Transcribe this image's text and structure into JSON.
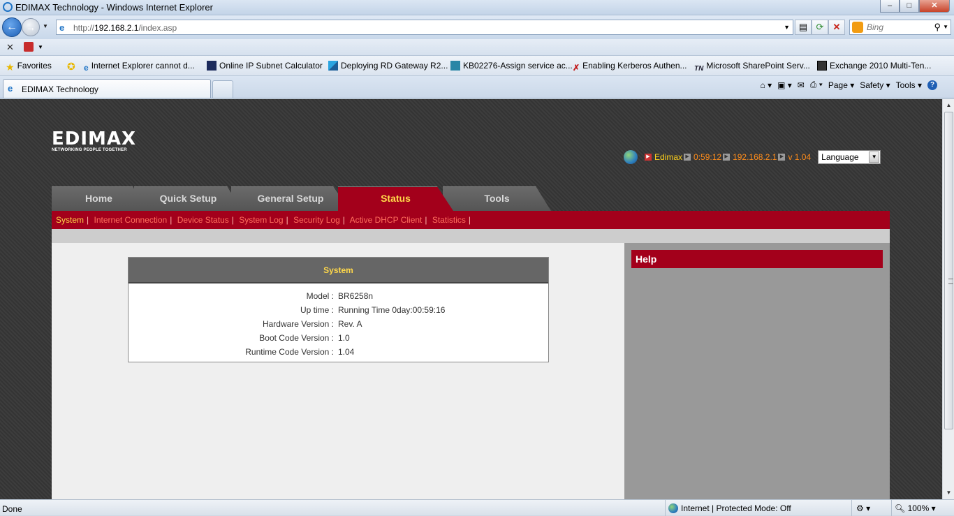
{
  "window": {
    "title": "EDIMAX Technology - Windows Internet Explorer",
    "min": "–",
    "max": "□",
    "close": "✕"
  },
  "address": {
    "prefix": "http://",
    "host": "192.168.2.1",
    "path": "/index.asp"
  },
  "search": {
    "placeholder": "Bing"
  },
  "favorites": {
    "label": "Favorites",
    "items": [
      "Internet Explorer cannot d...",
      "Online IP Subnet Calculator",
      "Deploying RD Gateway R2...",
      "KB02276-Assign service ac...",
      "Enabling Kerberos Authen...",
      "Microsoft SharePoint Serv...",
      "Exchange 2010 Multi-Ten..."
    ]
  },
  "tab": {
    "label": "EDIMAX Technology"
  },
  "commands": {
    "page": "Page ▾",
    "safety": "Safety ▾",
    "tools": "Tools ▾",
    "help": "?"
  },
  "router": {
    "logo": "EDIMAX",
    "tagline": "NETWORKING PEOPLE TOGETHER",
    "info": {
      "name": "Edimax",
      "uptime": "0:59:12",
      "ip": "192.168.2.1",
      "version": "v 1.04"
    },
    "language": "Language",
    "tabs": [
      {
        "label": "Home"
      },
      {
        "label": "Quick Setup"
      },
      {
        "label": "General Setup"
      },
      {
        "label": "Status"
      },
      {
        "label": "Tools"
      }
    ],
    "subnav": [
      "System",
      "Internet Connection",
      "Device Status",
      "System Log",
      "Security Log",
      "Active DHCP Client",
      "Statistics"
    ],
    "system": {
      "heading": "System",
      "rows": [
        {
          "key": "Model :",
          "value": "BR6258n"
        },
        {
          "key": "Up time :",
          "value": "Running Time 0day:00:59:16"
        },
        {
          "key": "Hardware Version :",
          "value": "Rev. A"
        },
        {
          "key": "Boot Code Version :",
          "value": "1.0"
        },
        {
          "key": "Runtime Code Version :",
          "value": "1.04"
        }
      ]
    },
    "help": "Help"
  },
  "status": {
    "left": "Done",
    "zone": "Internet | Protected Mode: Off",
    "zoom": "100%"
  }
}
